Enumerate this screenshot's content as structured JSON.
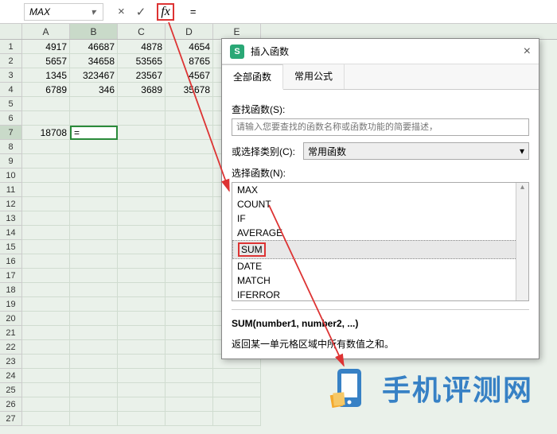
{
  "formula_bar": {
    "name_box": "MAX",
    "cancel_glyph": "×",
    "accept_glyph": "✓",
    "fx_label": "fx",
    "input_value": "="
  },
  "columns": [
    "A",
    "B",
    "C",
    "D",
    "E"
  ],
  "selected_col": "B",
  "rows": [
    1,
    2,
    3,
    4,
    5,
    6,
    7,
    8,
    9,
    10,
    11,
    12,
    13,
    14,
    15,
    16,
    17,
    18,
    19,
    20,
    21,
    22,
    23,
    24,
    25,
    26,
    27
  ],
  "selected_row": 7,
  "grid": {
    "A1": "4917",
    "B1": "46687",
    "C1": "4878",
    "D1": "4654",
    "A2": "5657",
    "B2": "34658",
    "C2": "53565",
    "D2": "8765",
    "A3": "1345",
    "B3": "323467",
    "C3": "23567",
    "D3": "4567",
    "A4": "6789",
    "B4": "346",
    "C4": "3689",
    "D4": "35678",
    "A7": "18708",
    "B7": "="
  },
  "dialog": {
    "title": "插入函数",
    "close_glyph": "×",
    "tabs": {
      "all": "全部函数",
      "common": "常用公式"
    },
    "search_label": "查找函数(S):",
    "search_placeholder": "请输入您要查找的函数名称或函数功能的简要描述，",
    "cat_label": "或选择类别(C):",
    "cat_value": "常用函数",
    "list_label": "选择函数(N):",
    "functions": [
      "MAX",
      "COUNT",
      "IF",
      "AVERAGE",
      "SUM",
      "DATE",
      "MATCH",
      "IFERROR"
    ],
    "selected_fn_index": 4,
    "fn_signature": "SUM(number1, number2, ...)",
    "fn_description": "返回某一单元格区域中所有数值之和。"
  },
  "watermark": {
    "text": "手机评测网"
  }
}
